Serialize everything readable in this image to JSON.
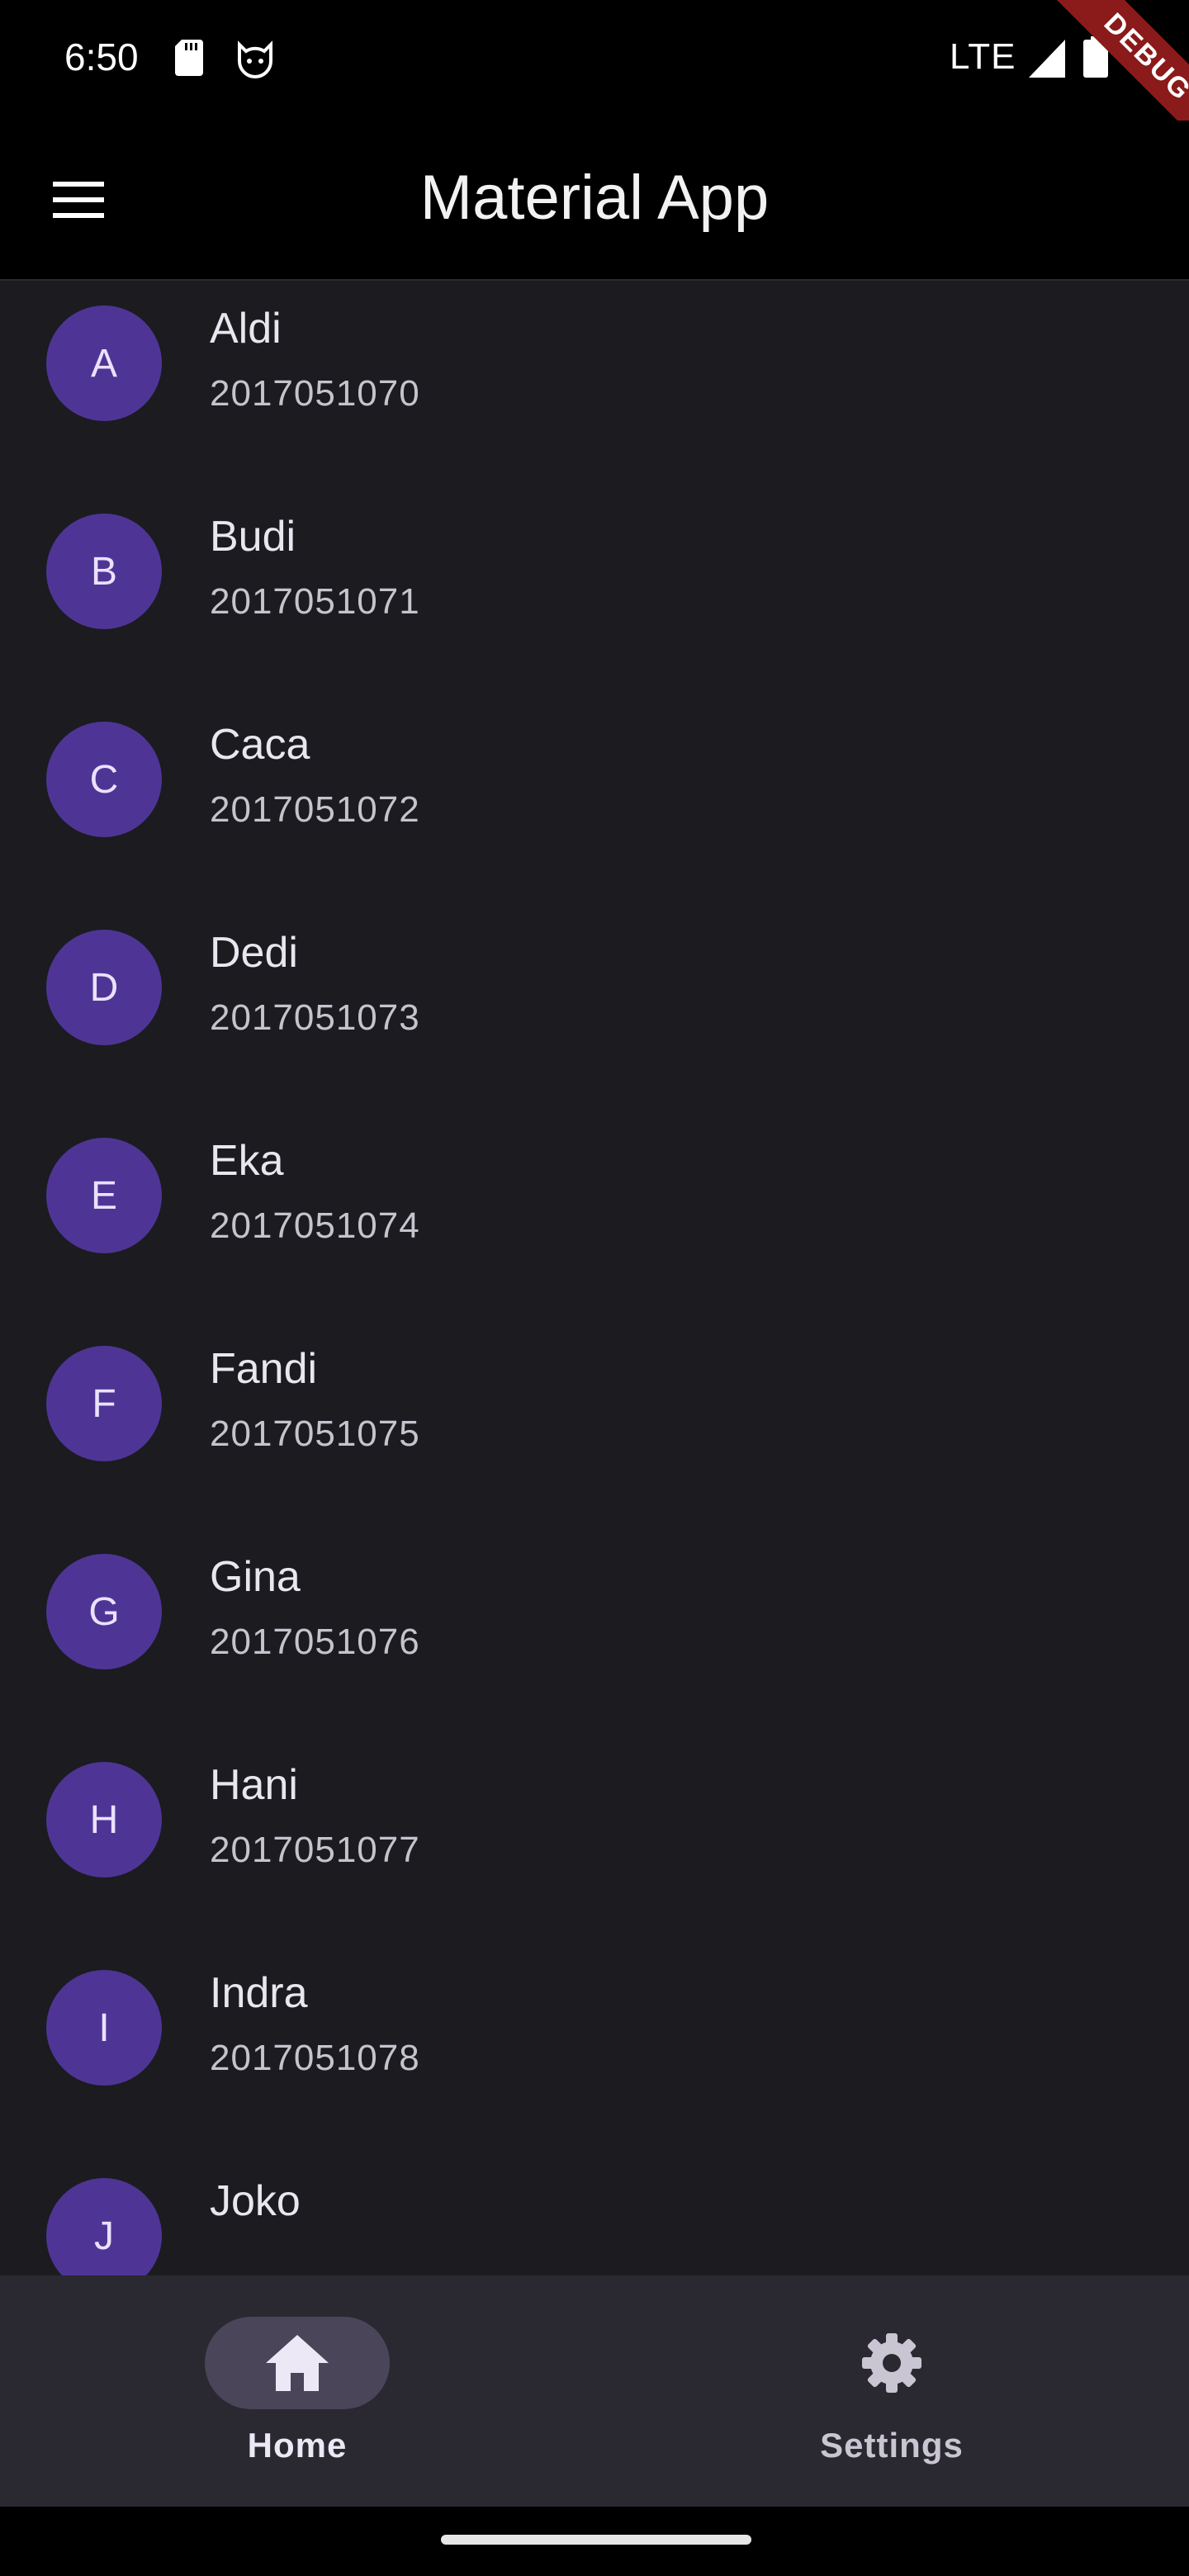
{
  "status_bar": {
    "time": "6:50",
    "network": "LTE",
    "icons": [
      "sd-card-icon",
      "cat-face-icon",
      "signal-icon",
      "battery-icon"
    ]
  },
  "debug_banner": "DEBUG",
  "app_bar": {
    "title": "Material App",
    "menu_icon": "menu-icon"
  },
  "list": {
    "items": [
      {
        "initial": "A",
        "name": "Aldi",
        "id": "2017051070"
      },
      {
        "initial": "B",
        "name": "Budi",
        "id": "2017051071"
      },
      {
        "initial": "C",
        "name": "Caca",
        "id": "2017051072"
      },
      {
        "initial": "D",
        "name": "Dedi",
        "id": "2017051073"
      },
      {
        "initial": "E",
        "name": "Eka",
        "id": "2017051074"
      },
      {
        "initial": "F",
        "name": "Fandi",
        "id": "2017051075"
      },
      {
        "initial": "G",
        "name": "Gina",
        "id": "2017051076"
      },
      {
        "initial": "H",
        "name": "Hani",
        "id": "2017051077"
      },
      {
        "initial": "I",
        "name": "Indra",
        "id": "2017051078"
      },
      {
        "initial": "J",
        "name": "Joko"
      }
    ]
  },
  "bottom_nav": {
    "items": [
      {
        "label": "Home",
        "icon": "home-icon",
        "selected": true
      },
      {
        "label": "Settings",
        "icon": "gear-icon",
        "selected": false
      }
    ]
  },
  "colors": {
    "background": "#1c1b20",
    "app_bar": "#000000",
    "avatar": "#4e3595",
    "nav_bar": "#2a2831",
    "nav_indicator": "#4a4558",
    "debug_ribbon": "#8b1a1a"
  }
}
